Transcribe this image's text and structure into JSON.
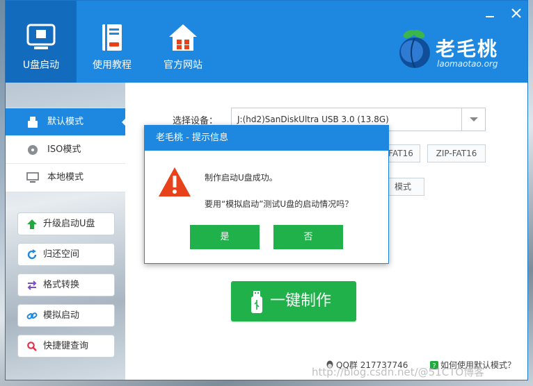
{
  "window": {
    "close_icon": "close-icon",
    "min_icon": "minimize-icon"
  },
  "nav": [
    {
      "label": "U盘启动",
      "icon": "usb-drive-icon",
      "active": true
    },
    {
      "label": "使用教程",
      "icon": "book-icon",
      "active": false
    },
    {
      "label": "官方网站",
      "icon": "home-icon",
      "active": false
    }
  ],
  "logo": {
    "title": "老毛桃",
    "url": "laomaotao.org"
  },
  "modes": [
    {
      "label": "默认模式",
      "icon": "usb-stick-icon",
      "active": true
    },
    {
      "label": "ISO模式",
      "icon": "disc-icon",
      "active": false
    },
    {
      "label": "本地模式",
      "icon": "monitor-icon",
      "active": false
    }
  ],
  "tools": [
    {
      "label": "升级启动U盘",
      "icon": "up-arrow-icon",
      "color": "#21a93f"
    },
    {
      "label": "归还空间",
      "icon": "refresh-icon",
      "color": "#1e88e0"
    },
    {
      "label": "格式转换",
      "icon": "swap-icon",
      "color": "#7b4fc9"
    },
    {
      "label": "模拟启动",
      "icon": "link-icon",
      "color": "#1e88e0"
    },
    {
      "label": "快捷键查询",
      "icon": "magnifier-icon",
      "color": "#e0334d"
    }
  ],
  "main": {
    "device_label": "选择设备：",
    "device_value": "J:(hd2)SanDiskUltra USB 3.0 (13.8G)",
    "option_fat16": "FAT16",
    "option_zip_fat16": "ZIP-FAT16",
    "option_mode": "模式",
    "make_button": "一键制作",
    "qq_group": "QQ群 217737746",
    "help_link": "如何使用默认模式？",
    "watermark": "http://blog.csdn.net/@51CTO博客"
  },
  "dialog": {
    "title": "老毛桃 - 提示信息",
    "message_1": "制作启动U盘成功。",
    "message_2": "要用“模拟启动”测试U盘的启动情况吗？",
    "yes_label": "是",
    "no_label": "否"
  },
  "colors": {
    "brand_blue": "#1e88e0",
    "active_blue": "#126bbd",
    "button_green": "#21b14a",
    "warning_red": "#e8421c"
  }
}
